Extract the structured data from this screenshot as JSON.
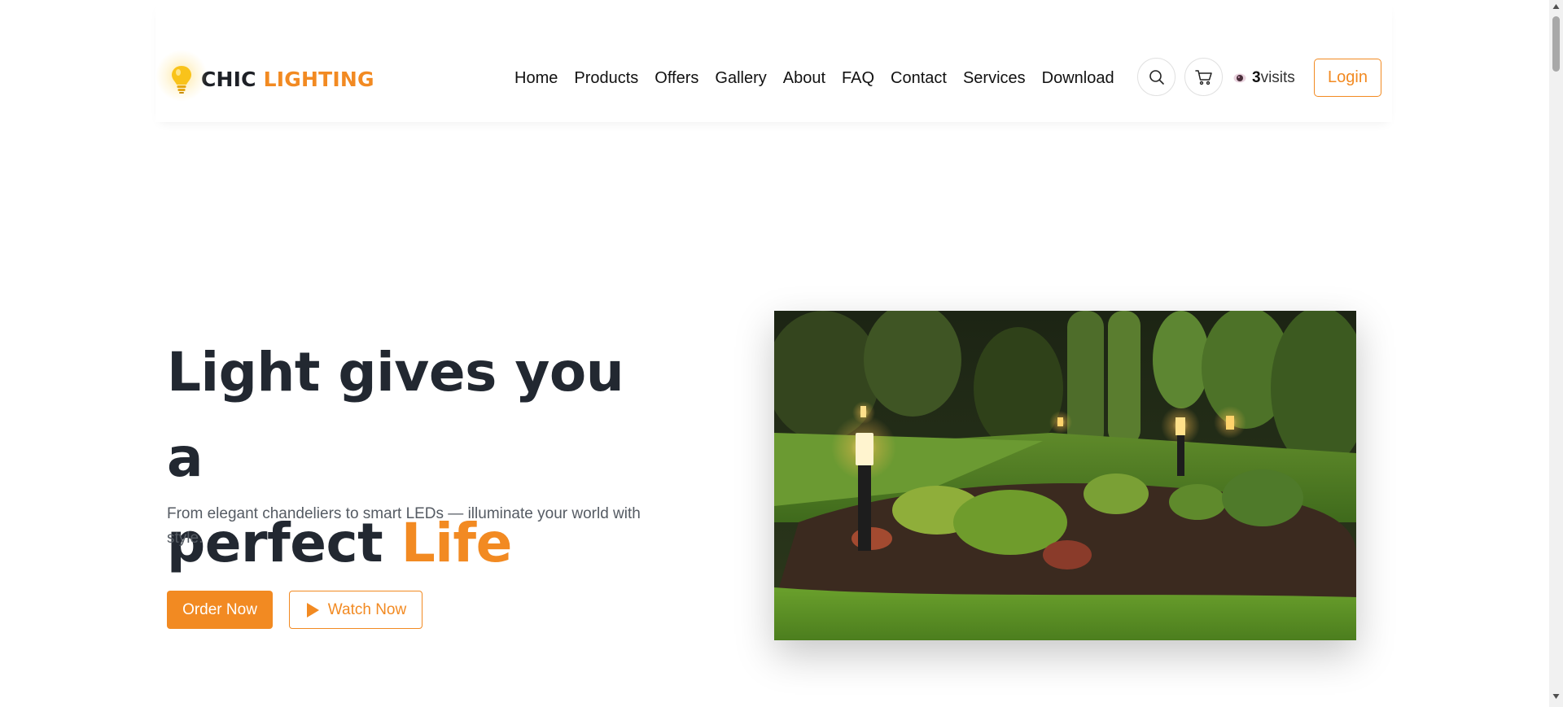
{
  "brand": {
    "name_dark": "CHIC",
    "name_accent": "LIGHTING",
    "icon": "lightbulb-icon"
  },
  "nav": {
    "items": [
      {
        "label": "Home"
      },
      {
        "label": "Products"
      },
      {
        "label": "Offers"
      },
      {
        "label": "Gallery"
      },
      {
        "label": "About"
      },
      {
        "label": "FAQ"
      },
      {
        "label": "Contact"
      },
      {
        "label": "Services"
      },
      {
        "label": "Download"
      }
    ]
  },
  "header_actions": {
    "search_icon": "search-icon",
    "cart_icon": "cart-icon",
    "visits_count": "3",
    "visits_label": "visits",
    "login_label": "Login"
  },
  "hero": {
    "title_line1": "Light gives you a",
    "title_line2_plain": "perfect",
    "title_line2_accent": "Life",
    "subtitle": "From elegant chandeliers to smart LEDs — illuminate your world with style.",
    "order_label": "Order Now",
    "watch_label": "Watch Now",
    "image_subject": "garden-path-lights-photo"
  },
  "colors": {
    "accent": "#f28a22",
    "heading": "#222831",
    "body_text": "#555b63"
  }
}
